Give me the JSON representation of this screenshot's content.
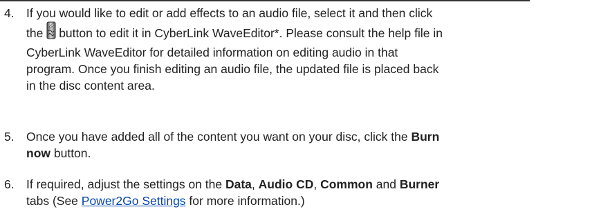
{
  "steps": [
    {
      "number": "4.",
      "line1": "If you would like to edit or add effects to an audio file, select it and then click",
      "line2_before_icon": "the ",
      "icon": "wave-editor-edit-icon",
      "line2_after_icon": "button to edit it in CyberLink WaveEditor*. Please consult the help file in",
      "line3": "CyberLink WaveEditor for detailed information on editing audio in that",
      "line4": "program. Once you finish editing an audio file, the updated file is placed back",
      "line5": "in the disc content area."
    },
    {
      "number": "5.",
      "text_a": "Once you have added all of the content you want on your disc, click the ",
      "bold_a": "Burn",
      "bold_b": "now",
      "text_b": " button."
    },
    {
      "number": "6.",
      "text_a": "If required, adjust the settings on the ",
      "tab_data": "Data",
      "sep1": ", ",
      "tab_audio": "Audio CD",
      "sep2": ", ",
      "tab_common": "Common",
      "sep3": " and ",
      "tab_burner": "Burner",
      "text_b": "tabs (See ",
      "link": "Power2Go Settings",
      "text_c": " for more information.)"
    }
  ]
}
